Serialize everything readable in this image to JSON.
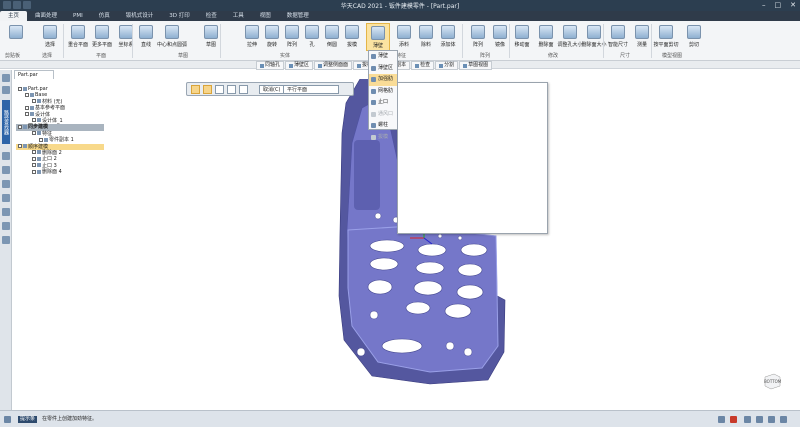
{
  "window": {
    "title": "华天CAD 2021 - 钣件建模零件 - [Part.par]"
  },
  "tabs": [
    "主页",
    "曲面处理",
    "PMI",
    "仿真",
    "钣机式设计",
    "3D 打印",
    "检查",
    "工具",
    "视图",
    "数据管理"
  ],
  "ribbon": {
    "buttons": [
      "选择",
      "重合平面",
      "更多平面",
      "坐标系",
      "直线",
      "中心和点圆弧",
      "草图",
      "拉伸",
      "旋转",
      "阵列",
      "孔",
      "倒圆",
      "拔模",
      "薄壁",
      "添料",
      "除料",
      "添加体",
      "阵列",
      "镜像",
      "移动面",
      "删除面",
      "调整孔大小",
      "删除面大小",
      "智能尺寸",
      "测量",
      "按平面剪切",
      "剪切"
    ],
    "groups": [
      "剪贴板",
      "选择",
      "平面",
      "草图",
      "实体",
      "特征",
      "阵列",
      "修改",
      "尺寸",
      "模型视图"
    ]
  },
  "command_bar": {
    "items": [
      "同轴孔",
      "薄壁区",
      "调整侧面面",
      "拔模",
      "零件副本",
      "检查",
      "分割",
      "草图视图"
    ]
  },
  "document_tab": "Part.par",
  "left_strip": {
    "vertical_tab": "路径查找器"
  },
  "tree": [
    {
      "label": "Part.par",
      "level": 0,
      "style": "normal"
    },
    {
      "label": "Base",
      "level": 1,
      "style": "normal"
    },
    {
      "label": "材料 (无)",
      "level": 2,
      "style": "normal"
    },
    {
      "label": "基本参考平面",
      "level": 1,
      "style": "normal"
    },
    {
      "label": "设计体",
      "level": 1,
      "style": "normal"
    },
    {
      "label": "设计体_1",
      "level": 2,
      "style": "normal"
    },
    {
      "label": "同步建模",
      "level": 0,
      "style": "bar"
    },
    {
      "label": "特征",
      "level": 2,
      "style": "normal"
    },
    {
      "label": "零件副本 1",
      "level": 3,
      "style": "normal"
    },
    {
      "label": "顺序建模",
      "level": 0,
      "style": "sel"
    },
    {
      "label": "删除面 2",
      "level": 2,
      "style": "normal"
    },
    {
      "label": "止口 2",
      "level": 2,
      "style": "normal"
    },
    {
      "label": "止口 3",
      "level": 2,
      "style": "normal"
    },
    {
      "label": "删除面 4",
      "level": 2,
      "style": "normal"
    }
  ],
  "mini_toolbar": {
    "cancel": "取消(C)",
    "plane": "平行平面"
  },
  "dropdown": {
    "items": [
      {
        "label": "薄壁",
        "state": "normal"
      },
      {
        "label": "薄壁区",
        "state": "normal"
      },
      {
        "label": "加强肋",
        "state": "hover"
      },
      {
        "label": "网格肋",
        "state": "normal"
      },
      {
        "label": "止口",
        "state": "normal"
      },
      {
        "label": "通风口",
        "state": "dim"
      },
      {
        "label": "螺柱",
        "state": "normal"
      },
      {
        "label": "拔模",
        "state": "dim"
      }
    ]
  },
  "viewcube": {
    "label": "BOTTOM"
  },
  "status": {
    "prompt_label": "提示条",
    "prompt": "在零件上创建加劲特征。"
  },
  "colors": {
    "part": "#7577c9",
    "part_dark": "#54579f",
    "ribbon_bg": "#f3f5f7",
    "title_bg": "#2c3e50",
    "highlight": "#f9dc97"
  }
}
